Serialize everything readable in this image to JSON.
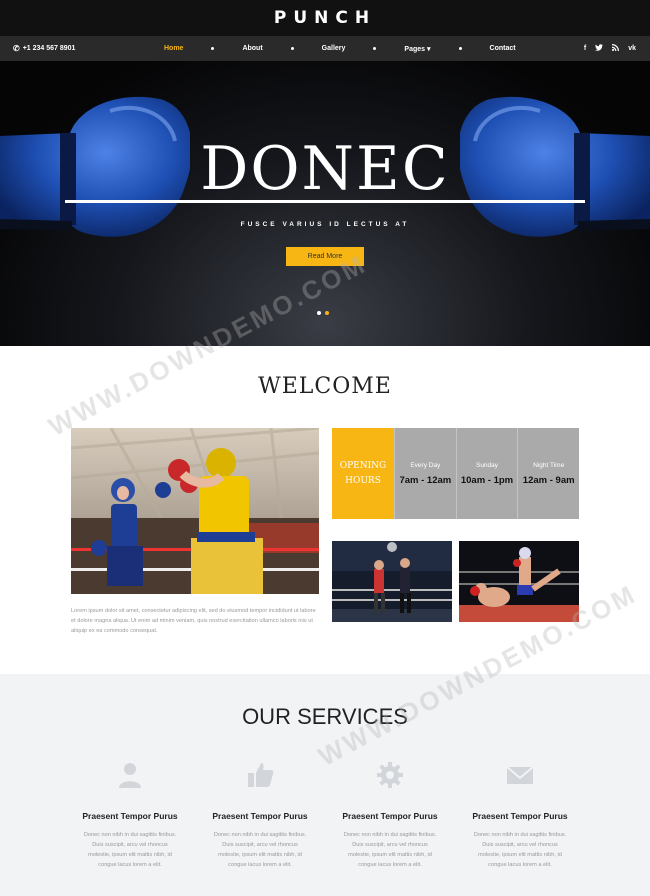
{
  "brand": {
    "name": "PUNCH"
  },
  "topbar": {
    "phone": "+1 234 567 8901"
  },
  "nav": {
    "items": [
      {
        "label": "Home"
      },
      {
        "label": "About"
      },
      {
        "label": "Gallery"
      },
      {
        "label": "Pages"
      },
      {
        "label": "Contact"
      }
    ],
    "pages_caret": "▾"
  },
  "socials": [
    "f",
    "t",
    "rss",
    "vk"
  ],
  "hero": {
    "title": "DONEC",
    "subtitle": "FUSCE VARIUS ID LECTUS AT",
    "button": "Read More",
    "slides": 2,
    "active_slide": 2
  },
  "welcome": {
    "title": "WELCOME",
    "text": "Lorem ipsum dolor sit amet, consectetur adipiscing elit, sed do eiusmod tempor incididunt ut labore et dolore magna aliqua. Ut enim ad minim veniam, quis nostrud exercitation ullamco laboris nisi ut aliquip ex ea commodo consequat."
  },
  "hours": {
    "label_line1": "OPENING",
    "label_line2": "HOURS",
    "columns": [
      {
        "day": "Every Day",
        "time": "7am - 12am"
      },
      {
        "day": "Sunday",
        "time": "10am - 1pm"
      },
      {
        "day": "Night Time",
        "time": "12am - 9am"
      }
    ]
  },
  "services": {
    "title": "OUR SERVICES",
    "items": [
      {
        "icon": "user-icon",
        "title": "Praesent Tempor Purus",
        "text": "Donec non nibh in dui sagittis finibus. Duis suscipit, arcu vel rhoncus molestie, ipsum elit mattis nibh, id congue lacus lorem a elit."
      },
      {
        "icon": "thumbs-up-icon",
        "title": "Praesent Tempor Purus",
        "text": "Donec non nibh in dui sagittis finibus. Duis suscipit, arcu vel rhoncus molestie, ipsum elit mattis nibh, id congue lacus lorem a elit."
      },
      {
        "icon": "gear-icon",
        "title": "Praesent Tempor Purus",
        "text": "Donec non nibh in dui sagittis finibus. Duis suscipit, arcu vel rhoncus molestie, ipsum elit mattis nibh, id congue lacus lorem a elit."
      },
      {
        "icon": "envelope-icon",
        "title": "Praesent Tempor Purus",
        "text": "Donec non nibh in dui sagittis finibus. Duis suscipit, arcu vel rhoncus molestie, ipsum elit mattis nibh, id congue lacus lorem a elit."
      }
    ]
  },
  "watermark": "WWW.DOWNDEMO.COM",
  "colors": {
    "accent": "#f7b614",
    "dark": "#111111",
    "nav": "#2a2a2a",
    "hours_grey": "#aaaaaa",
    "glove_blue": "#1e4fb3"
  }
}
